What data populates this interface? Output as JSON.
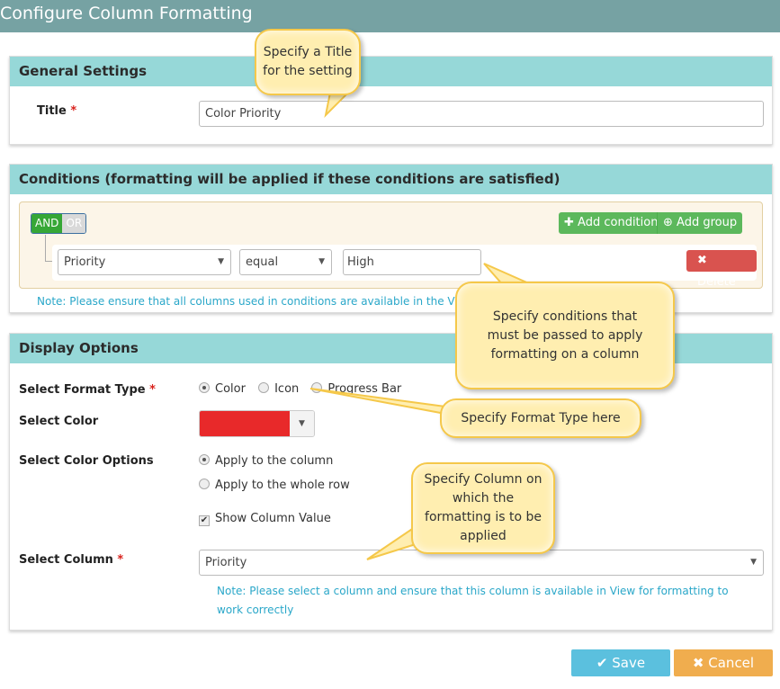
{
  "window": {
    "title": "Configure Column Formatting"
  },
  "general": {
    "heading": "General Settings",
    "title_label": "Title",
    "required_mark": "*",
    "title_value": "Color Priority"
  },
  "conditions": {
    "heading": "Conditions (formatting will be applied if these conditions are satisfied)",
    "and_label": "AND",
    "or_label": "OR",
    "selected_logic": "AND",
    "add_condition_label": "Add condition",
    "add_group_label": "Add group",
    "rule": {
      "field": "Priority",
      "operator": "equal",
      "value": "High"
    },
    "delete_label": "Delete",
    "note": "Note: Please ensure that all columns used in conditions are available in the View"
  },
  "display": {
    "heading": "Display Options",
    "format_type_label": "Select Format Type",
    "format_types": [
      {
        "label": "Color",
        "selected": true
      },
      {
        "label": "Icon",
        "selected": false
      },
      {
        "label": "Progress Bar",
        "selected": false
      }
    ],
    "select_color_label": "Select Color",
    "selected_color": "#e8292a",
    "color_options_label": "Select Color Options",
    "color_options": [
      {
        "label": "Apply to the column",
        "selected": true
      },
      {
        "label": "Apply to the whole row",
        "selected": false
      }
    ],
    "show_column_value_label": "Show Column Value",
    "show_column_value_checked": true,
    "select_column_label": "Select Column",
    "selected_column": "Priority",
    "column_note": "Note: Please select a column and ensure that this column is available in View for formatting to work correctly"
  },
  "footer": {
    "save_label": "Save",
    "cancel_label": "Cancel"
  },
  "callouts": {
    "title": "Specify a Title for the setting",
    "conditions": "Specify conditions that must be passed to apply formatting on a column",
    "format_type": "Specify Format Type here",
    "column": "Specify Column on which the formatting is to be applied"
  }
}
